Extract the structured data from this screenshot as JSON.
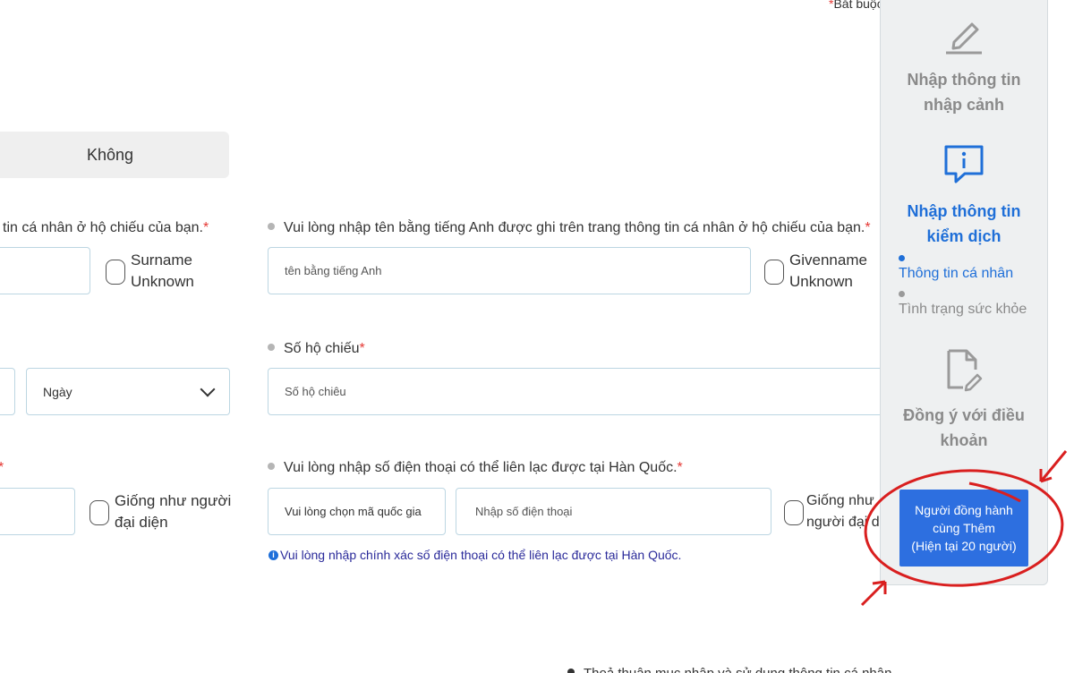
{
  "required_note": {
    "mark": "*",
    "text": "Bắt buộc"
  },
  "khong_button": {
    "label": "Không"
  },
  "surname": {
    "label": "tin cá nhân ở hộ chiếu của bạn.",
    "checkbox_label_line1": "Surname",
    "checkbox_label_line2": "Unknown"
  },
  "givenname": {
    "label": "Vui lòng nhập tên bằng tiếng Anh được ghi trên trang thông tin cá nhân ở hộ chiếu của bạn.",
    "placeholder": "tên bằng tiếng Anh",
    "checkbox_label_line1": "Givenname",
    "checkbox_label_line2": "Unknown"
  },
  "dob": {
    "day_select": "Ngày"
  },
  "passport": {
    "label": "Số hộ chiếu",
    "placeholder": "Số hộ chiêu"
  },
  "representative": {
    "checkbox_label_line1": "Giống như người",
    "checkbox_label_line2": "đại diện"
  },
  "phone": {
    "label": "Vui lòng nhập số điện thoại có thể liên lạc được tại Hàn Quốc.",
    "country_placeholder": "Vui lòng chọn mã quốc gia",
    "number_placeholder": "Nhập số điện thoại",
    "checkbox_label_line1": "Giống như",
    "checkbox_label_line2": "người đại di",
    "note": "Vui lòng nhập chính xác số điện thoại có thể liên lạc được tại Hàn Quốc."
  },
  "bottom_text": "Thoả thuận mục nhập và sử dụng thông tin cá nhân",
  "sidebar": {
    "step1": {
      "line1": "Nhập thông tin",
      "line2": "nhập cảnh",
      "icon": "pencil-icon"
    },
    "step2": {
      "line1": "Nhập thông tin",
      "line2": "kiểm dịch",
      "icon": "info-icon",
      "sub1": "Thông tin cá nhân",
      "sub2": "Tình trạng sức khỏe"
    },
    "step3": {
      "line1": "Đồng ý với điều",
      "line2": "khoản",
      "icon": "document-edit-icon"
    },
    "add_companion": {
      "line1": "Người đồng hành",
      "line2": "cùng Thêm",
      "line3": "(Hiện tại 20 người)"
    }
  },
  "colors": {
    "accent": "#1f6fd8",
    "button": "#2d6fe0",
    "required": "#e53935",
    "annotation": "#d91f1f"
  }
}
